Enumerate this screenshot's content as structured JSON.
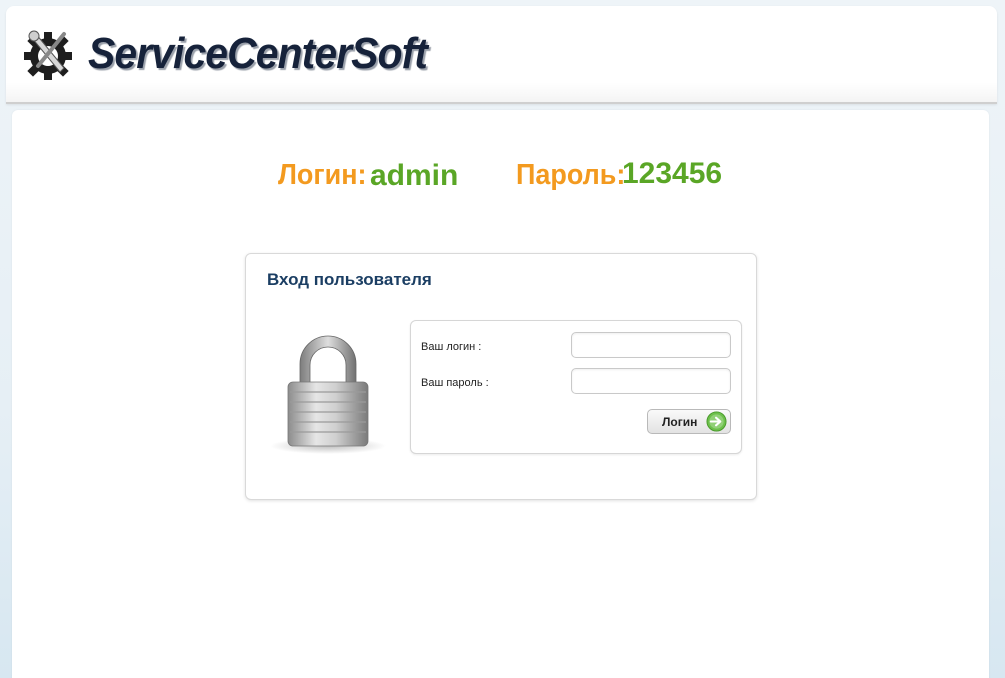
{
  "header": {
    "brand": "ServiceCenterSoft",
    "logo_icon": "gear-wrench-icon"
  },
  "credentials": {
    "login_label": "Логин:",
    "login_value": "admin",
    "password_label": "Пароль:",
    "password_value": "123456"
  },
  "login": {
    "title": "Вход пользователя",
    "lock_icon": "padlock-icon",
    "username_label": "Ваш логин :",
    "username_value": "",
    "password_label": "Ваш пароль :",
    "password_value": "",
    "submit_label": "Логин",
    "submit_icon": "arrow-right-circle-icon"
  },
  "colors": {
    "accent_orange": "#f39a1f",
    "accent_green": "#5aa626",
    "title_blue": "#1b3e63",
    "brand_dark": "#16223a"
  }
}
